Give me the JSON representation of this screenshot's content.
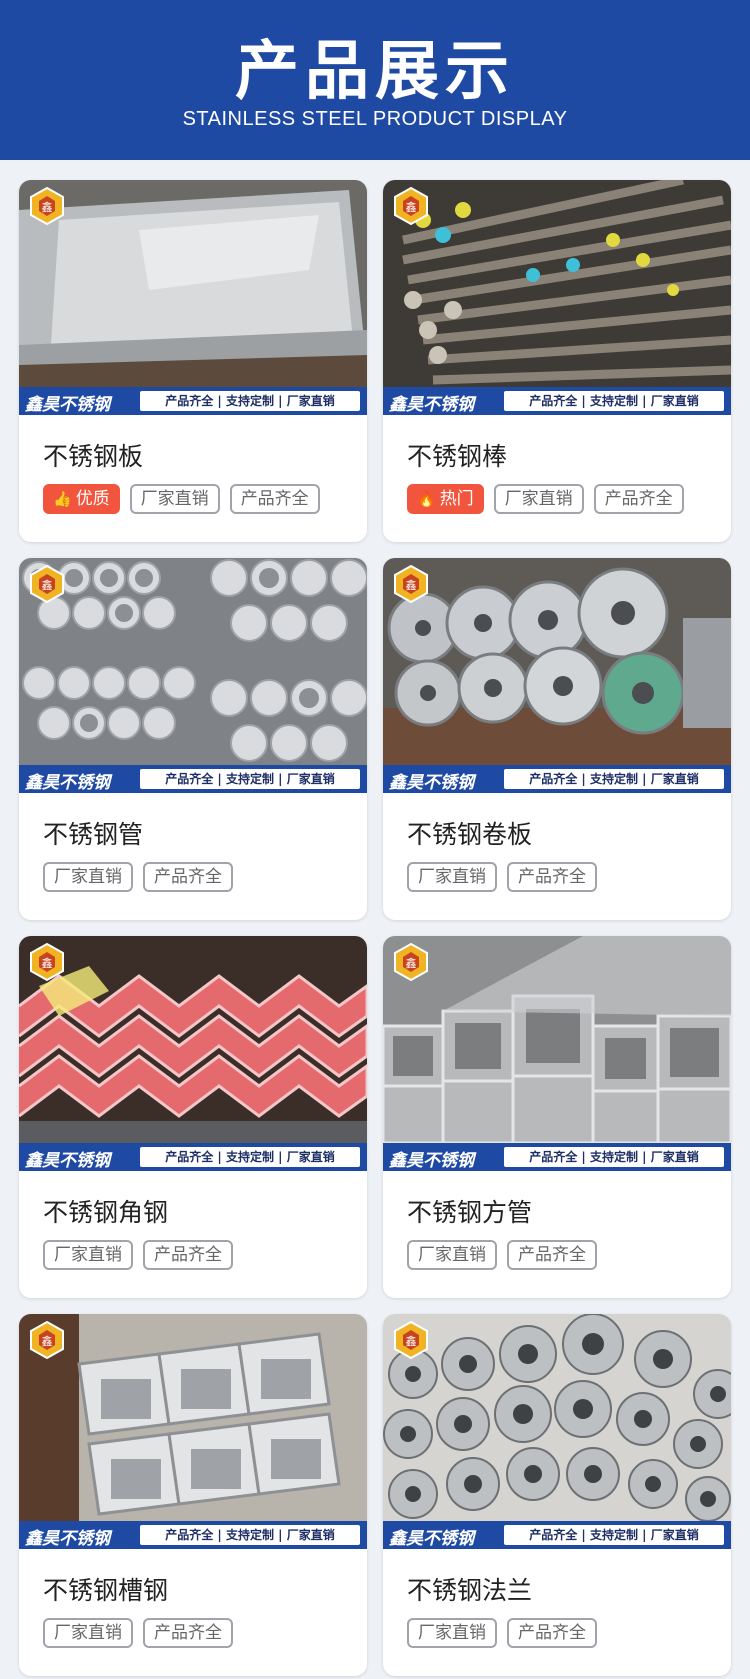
{
  "header": {
    "title": "产品展示",
    "subtitle": "STAINLESS STEEL PRODUCT DISPLAY",
    "bg_color": "#1f4aa3"
  },
  "banner": {
    "brand": "鑫昊不锈钢",
    "tagline": "产品齐全 | 支持定制 | 厂家直销"
  },
  "products": [
    {
      "name": "不锈钢板",
      "photo_icon": "steel-plate-photo",
      "badge": {
        "label": "优质",
        "icon": "thumbs-up-icon"
      },
      "tags": [
        "厂家直销",
        "产品齐全"
      ]
    },
    {
      "name": "不锈钢棒",
      "photo_icon": "steel-bar-photo",
      "badge": {
        "label": "热门",
        "icon": "flame-icon"
      },
      "tags": [
        "厂家直销",
        "产品齐全"
      ]
    },
    {
      "name": "不锈钢管",
      "photo_icon": "steel-pipe-photo",
      "tags": [
        "厂家直销",
        "产品齐全"
      ]
    },
    {
      "name": "不锈钢卷板",
      "photo_icon": "steel-coil-photo",
      "tags": [
        "厂家直销",
        "产品齐全"
      ]
    },
    {
      "name": "不锈钢角钢",
      "photo_icon": "angle-steel-photo",
      "tags": [
        "厂家直销",
        "产品齐全"
      ]
    },
    {
      "name": "不锈钢方管",
      "photo_icon": "square-tube-photo",
      "tags": [
        "厂家直销",
        "产品齐全"
      ]
    },
    {
      "name": "不锈钢槽钢",
      "photo_icon": "channel-steel-photo",
      "tags": [
        "厂家直销",
        "产品齐全"
      ]
    },
    {
      "name": "不锈钢法兰",
      "photo_icon": "flange-photo",
      "tags": [
        "厂家直销",
        "产品齐全"
      ]
    }
  ]
}
